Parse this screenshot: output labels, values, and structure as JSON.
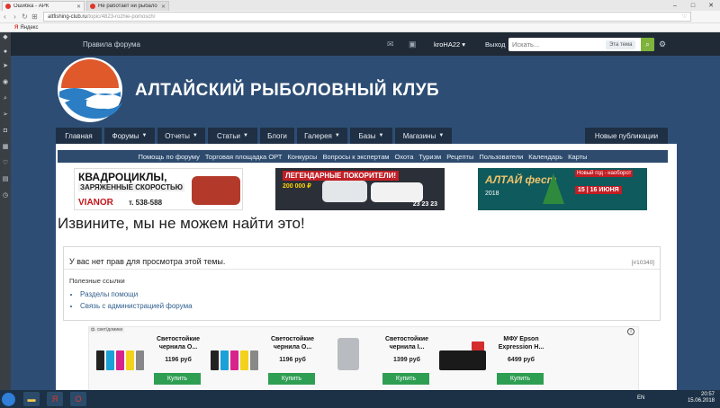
{
  "browser": {
    "tabs": [
      {
        "label": "Ошибка - АРК",
        "active": true
      },
      {
        "label": "Не работает ни рыбало",
        "active": false
      }
    ],
    "url_domain": "altfishing-club.ru",
    "url_path": "/topic/4823-rozhie-pomosch/",
    "bookmark": "Яндекс"
  },
  "topbar": {
    "rules": "Правила форума",
    "user": "kroHA22",
    "exit": "Выход",
    "search_placeholder": "Искать...",
    "search_scope": "Эта тема"
  },
  "site": {
    "title": "АЛТАЙСКИЙ РЫБОЛОВНЫЙ КЛУБ"
  },
  "nav": {
    "items": [
      "Главная",
      "Форумы",
      "Отчеты",
      "Статьи",
      "Блоги",
      "Галерея",
      "Базы",
      "Магазины"
    ],
    "new_publications": "Новые публикации"
  },
  "categories": [
    "Помощь по форуму",
    "Торговая площадка ОРТ",
    "Конкурсы",
    "Вопросы к экспертам",
    "Охота",
    "Туризм",
    "Рецепты",
    "Пользователи",
    "Календарь",
    "Карты"
  ],
  "banners": {
    "b1": {
      "line1": "КВАДРОЦИКЛЫ,",
      "line2": "ЗАРЯЖЕННЫЕ СКОРОСТЬЮ",
      "brand": "VIANOR",
      "phone": "т. 538-588"
    },
    "b2": {
      "line1": "ЛЕГЕНДАРНЫЕ ПОКОРИТЕЛИ!",
      "line2": "200 000 ₽",
      "line3": "23 23 23"
    },
    "b3": {
      "line1": "АЛТАЙ фест",
      "line2": "2018",
      "line3": "Новый год - наоборот",
      "line4": "15 | 16 ИЮНЯ"
    }
  },
  "page": {
    "heading": "Извините, мы не можем найти это!",
    "message": "У вас нет прав для просмотра этой темы.",
    "error_code": "[#10340]",
    "useful_links_title": "Полезные ссылки",
    "links": [
      "Разделы помощи",
      "Связь с администрацией форума"
    ]
  },
  "ads": {
    "label": "ф. свет/домики",
    "items": [
      {
        "name": "Светостойкие чернила О...",
        "price": "1196 руб",
        "buy": "Купить"
      },
      {
        "name": "Светостойкие чернила О...",
        "price": "1196 руб",
        "buy": "Купить"
      },
      {
        "name": "Светостойкие чернила I...",
        "price": "1399 руб",
        "buy": "Купить"
      },
      {
        "name": "МФУ Epson Expression H...",
        "price": "6499 руб",
        "buy": "Купить"
      }
    ]
  },
  "taskbar": {
    "lang": "EN",
    "time": "20:57",
    "date": "15.06.2018"
  },
  "colors": {
    "bg": "#2d4d74",
    "nav": "#1f2f44",
    "buy": "#2e9e52",
    "go": "#7fb33c"
  }
}
